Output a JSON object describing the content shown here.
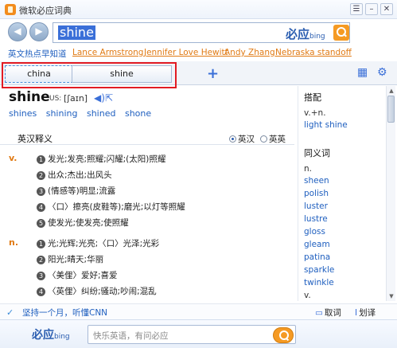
{
  "app": {
    "title": "微软必应词典"
  },
  "search": {
    "query": "shine",
    "logo_text": "必应",
    "logo_sub": "bing"
  },
  "hot": {
    "label": "英文热点早知道",
    "links": [
      "Lance Armstrong",
      "Jennifer Love Hewitt",
      "Andy Zhang",
      "Nebraska standoff"
    ]
  },
  "tabs": [
    {
      "label": "china"
    },
    {
      "label": "shine"
    }
  ],
  "entry": {
    "headword": "shine",
    "phon_label": "US:",
    "phonetic": "[ʃaɪn]",
    "forms": [
      "shines",
      "shining",
      "shined",
      "shone"
    ]
  },
  "section": {
    "title": "英汉释义",
    "radio_a": "英汉",
    "radio_b": "英英"
  },
  "verb": {
    "pos": "v.",
    "senses": [
      "发光;发亮;照耀;闪耀;(太阳)照耀",
      "出众;杰出;出风头",
      "(情感等)明显;流露",
      "〈口〉擦亮(皮鞋等);磨光;以灯等照耀",
      "使发光;使发亮;使照耀"
    ]
  },
  "noun": {
    "pos": "n.",
    "senses": [
      "光;光辉;光亮;〈口〉光泽;光彩",
      "阳光;晴天;华丽",
      "〈美俚〉爱好;喜爱",
      "〈英俚〉纠纷;骚动;吵闹;混乱"
    ]
  },
  "sidebar": {
    "collocation_title": "搭配",
    "collocation_text": "v.+n.",
    "collocation_link": "light shine",
    "synonym_title": "同义词",
    "synonym_pos_n": "n.",
    "synonyms": [
      "sheen",
      "polish",
      "luster",
      "lustre",
      "gloss",
      "gleam",
      "patina",
      "sparkle",
      "twinkle"
    ],
    "synonym_pos_v": "v."
  },
  "status": {
    "message": "坚持一个月，听懂CNN",
    "btn_lookup": "取词",
    "btn_translate": "划译"
  },
  "bottom": {
    "logo_text": "必应",
    "logo_sub": "bing",
    "placeholder": "快乐英语，有问必应"
  }
}
